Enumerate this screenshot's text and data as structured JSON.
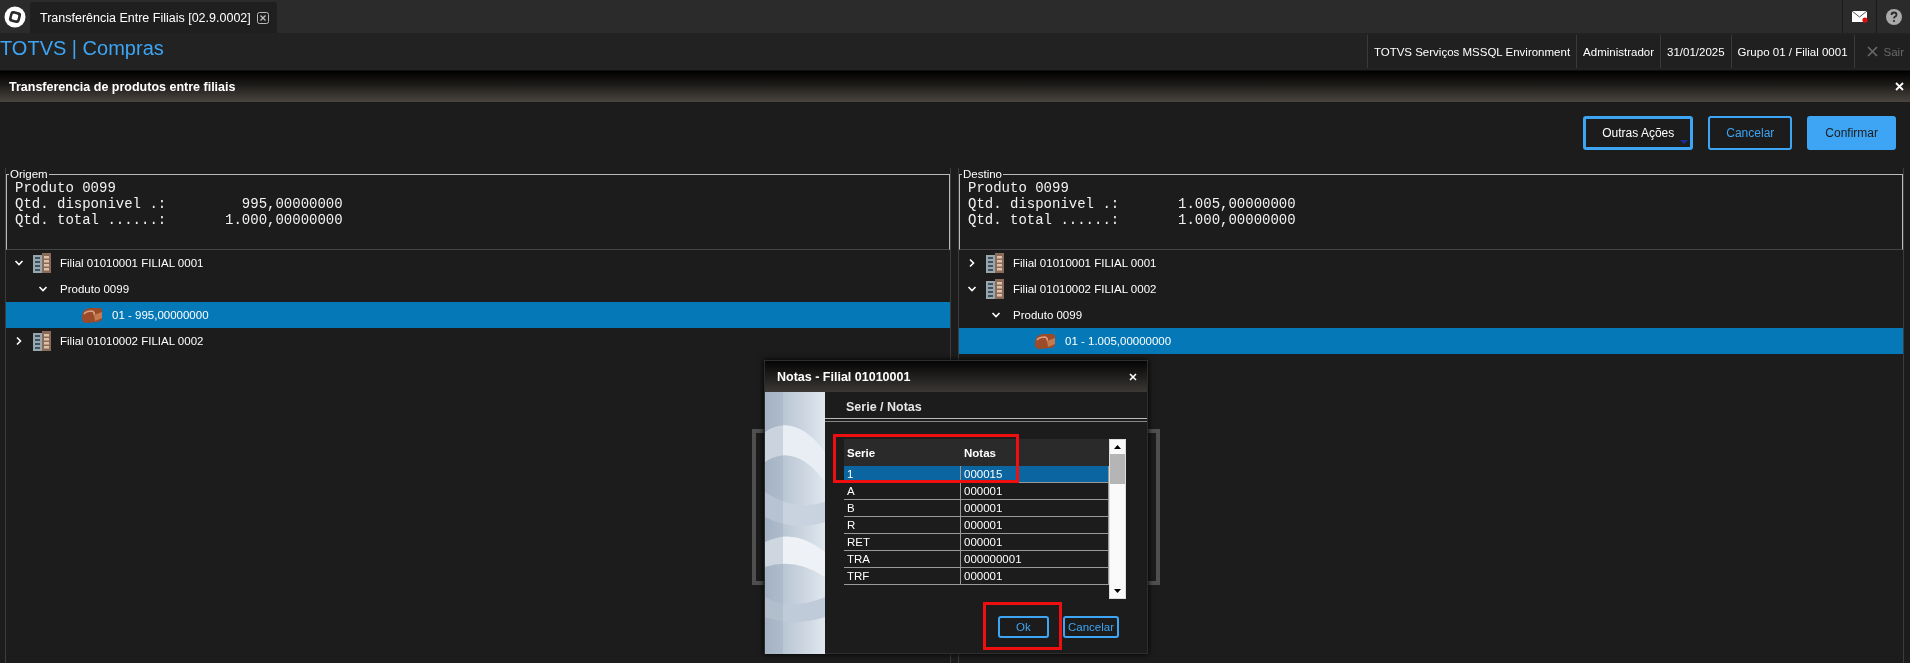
{
  "app_tab": {
    "title": "Transferência Entre Filiais [02.9.0002]"
  },
  "notifications": {
    "unread": true
  },
  "header": {
    "brand": "TOTVS | Compras",
    "info": [
      "TOTVS Serviços MSSQL Environment",
      "Administrador",
      "31/01/2025",
      "Grupo 01 / Filial 0001"
    ],
    "logout": {
      "label": "Sair",
      "disabled": true
    }
  },
  "page": {
    "title": "Transferencia de produtos entre filiais"
  },
  "actions": [
    {
      "label": "Outras Ações",
      "kind": "menu"
    },
    {
      "label": "Cancelar",
      "kind": "secondary"
    },
    {
      "label": "Confirmar",
      "kind": "primary"
    }
  ],
  "panels": [
    {
      "legend": "Origem",
      "info": [
        "Produto 0099",
        "Qtd. disponivel .:         995,00000000",
        "Qtd. total ......:       1.000,00000000"
      ],
      "tree": [
        {
          "label": "Filial 01010001 FILIAL 0001",
          "kind": "branch",
          "expanded": true,
          "selected": false,
          "children": [
            {
              "label": "Produto 0099",
              "kind": "product",
              "expanded": true,
              "selected": false,
              "children": [
                {
                  "label": "01 - 995,00000000",
                  "kind": "lot",
                  "selected": true
                }
              ]
            }
          ]
        },
        {
          "label": "Filial 01010002 FILIAL 0002",
          "kind": "branch",
          "expanded": false,
          "selected": false
        }
      ]
    },
    {
      "legend": "Destino",
      "info": [
        "Produto 0099",
        "Qtd. disponivel .:       1.005,00000000",
        "Qtd. total ......:       1.000,00000000"
      ],
      "tree": [
        {
          "label": "Filial 01010001 FILIAL 0001",
          "kind": "branch",
          "expanded": false,
          "selected": false
        },
        {
          "label": "Filial 01010002 FILIAL 0002",
          "kind": "branch",
          "expanded": true,
          "selected": false,
          "children": [
            {
              "label": "Produto 0099",
              "kind": "product",
              "expanded": true,
              "selected": false,
              "children": [
                {
                  "label": "01 - 1.005,00000000",
                  "kind": "lot",
                  "selected": true
                }
              ]
            }
          ]
        }
      ]
    }
  ],
  "dialog": {
    "title": "Notas - Filial 01010001",
    "heading": "Serie / Notas",
    "table": {
      "columns": [
        "Serie",
        "Notas"
      ],
      "annotated": true,
      "rows": [
        {
          "cells": [
            "1",
            "000015"
          ],
          "selected": true
        },
        {
          "cells": [
            "A",
            "000001"
          ],
          "selected": false
        },
        {
          "cells": [
            "B",
            "000001"
          ],
          "selected": false
        },
        {
          "cells": [
            "R",
            "000001"
          ],
          "selected": false
        },
        {
          "cells": [
            "RET",
            "000001"
          ],
          "selected": false
        },
        {
          "cells": [
            "TRA",
            "000000001"
          ],
          "selected": false
        },
        {
          "cells": [
            "TRF",
            "000001"
          ],
          "selected": false
        }
      ]
    },
    "buttons": [
      {
        "label": "Ok",
        "annotated": true
      },
      {
        "label": "Cancelar",
        "annotated": false
      }
    ]
  }
}
